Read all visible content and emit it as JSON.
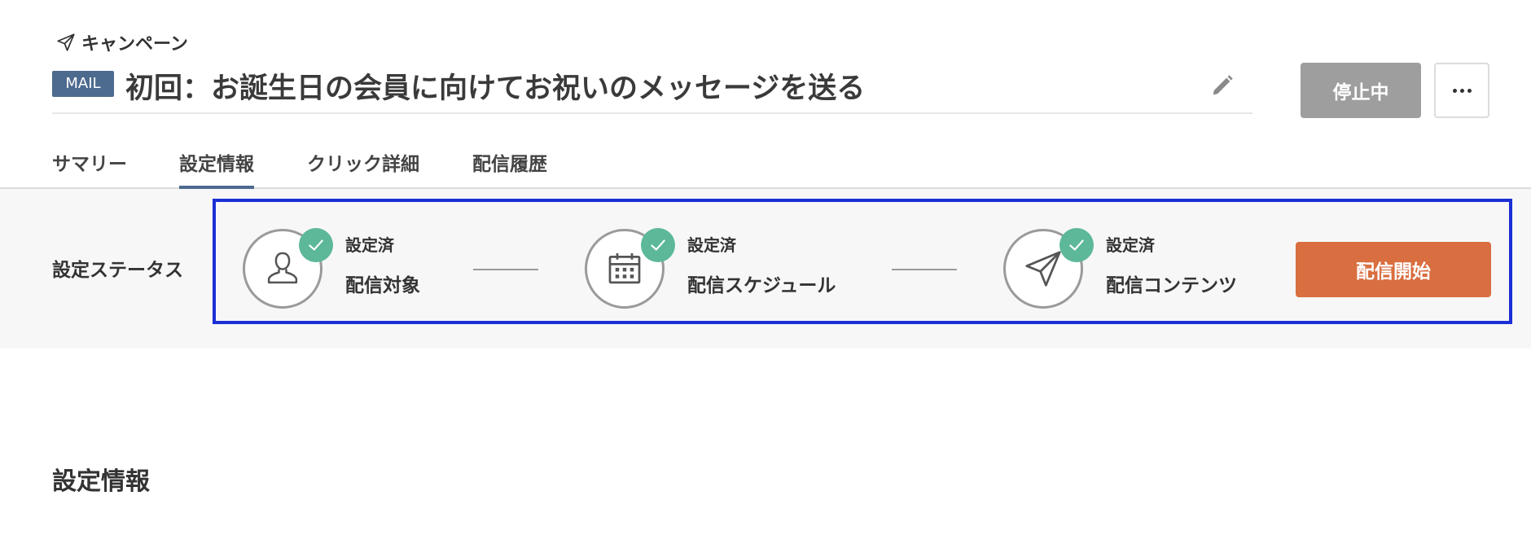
{
  "breadcrumb": {
    "icon": "paper-plane-icon",
    "label": "キャンペーン"
  },
  "campaign": {
    "badge": "MAIL",
    "title": "初回：お誕生日の会員に向けてお祝いのメッセージを送る",
    "edit_icon": "pencil-icon"
  },
  "actions": {
    "stop_label": "停止中",
    "more_icon": "more-dots-icon"
  },
  "tabs": [
    {
      "label": "サマリー",
      "active": false
    },
    {
      "label": "設定情報",
      "active": true
    },
    {
      "label": "クリック詳細",
      "active": false
    },
    {
      "label": "配信履歴",
      "active": false
    }
  ],
  "status": {
    "label": "設定ステータス",
    "steps": [
      {
        "state": "設定済",
        "name": "配信対象",
        "icon": "person-icon"
      },
      {
        "state": "設定済",
        "name": "配信スケジュール",
        "icon": "calendar-icon"
      },
      {
        "state": "設定済",
        "name": "配信コンテンツ",
        "icon": "paper-plane-icon"
      }
    ],
    "start_label": "配信開始"
  },
  "section": {
    "title": "設定情報"
  },
  "colors": {
    "badge": "#4d6a8f",
    "stop_button": "#9e9e9e",
    "start_button": "#d96e40",
    "check": "#5db89a",
    "highlight_box": "#1a2fd6",
    "band": "#f7f7f7"
  }
}
